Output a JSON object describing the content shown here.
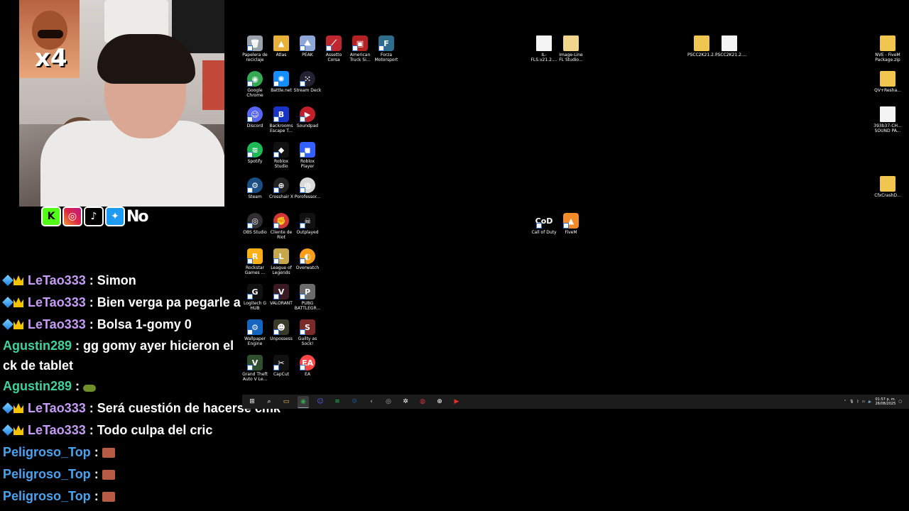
{
  "overlay": {
    "multiplier": "x4",
    "social_text": "No"
  },
  "chat": [
    {
      "user": "LeTao333",
      "badges": true,
      "color": "#c59cf6",
      "text": "Simon"
    },
    {
      "user": "LeTao333",
      "badges": true,
      "color": "#c59cf6",
      "text": "Bien verga pa pegarle a"
    },
    {
      "user": "LeTao333",
      "badges": true,
      "color": "#c59cf6",
      "text": "Bolsa 1-gomy 0"
    },
    {
      "user": "Agustin289",
      "badges": false,
      "color": "#3fd39c",
      "text": "gg gomy ayer hicieron el ck de tablet"
    },
    {
      "user": "Agustin289",
      "badges": false,
      "color": "#3fd39c",
      "text": ""
    },
    {
      "user": "LeTao333",
      "badges": true,
      "color": "#c59cf6",
      "text": "Será cuestión de hacerse cmk"
    },
    {
      "user": "LeTao333",
      "badges": true,
      "color": "#c59cf6",
      "text": "Todo culpa del cric"
    },
    {
      "user": "Peligroso_Top",
      "badges": false,
      "color": "#4aa3f0",
      "text": ""
    },
    {
      "user": "Peligroso_Top",
      "badges": false,
      "color": "#4aa3f0",
      "text": ""
    },
    {
      "user": "Peligroso_Top",
      "badges": false,
      "color": "#4aa3f0",
      "text": ""
    }
  ],
  "desktop_icons": [
    {
      "label": "Papelera de reciclaje",
      "icon": "recycle-bin-icon",
      "color": "#9aa3ad",
      "glyph": "🗑"
    },
    {
      "label": "Atlas",
      "icon": "folder-icon",
      "color": "#e8b23a",
      "glyph": "▲"
    },
    {
      "label": "PEAK",
      "icon": "peak-icon",
      "color": "#8fa6d8",
      "glyph": "⛰"
    },
    {
      "label": "Assetto Corsa",
      "icon": "assetto-corsa-icon",
      "color": "#c0262d",
      "glyph": "⟋"
    },
    {
      "label": "American Truck Si...",
      "icon": "truck-icon",
      "color": "#b22222",
      "glyph": "▣"
    },
    {
      "label": "Forza Motorsport",
      "icon": "forza-icon",
      "color": "#2d6c8a",
      "glyph": "F"
    },
    {
      "label": "Google Chrome",
      "icon": "chrome-icon",
      "color": "#34a853",
      "glyph": "◉"
    },
    {
      "label": "Battle.net",
      "icon": "battlenet-icon",
      "color": "#148eff",
      "glyph": "✺"
    },
    {
      "label": "Stream Deck",
      "icon": "stream-deck-icon",
      "color": "#222233",
      "glyph": "⁙"
    },
    {
      "label": "Discord",
      "icon": "discord-icon",
      "color": "#5865f2",
      "glyph": "☺"
    },
    {
      "label": "Backrooms Escape T...",
      "icon": "backrooms-icon",
      "color": "#1a33c7",
      "glyph": "B"
    },
    {
      "label": "Soundpad",
      "icon": "soundpad-icon",
      "color": "#c0202a",
      "glyph": "▶"
    },
    {
      "label": "Spotify",
      "icon": "spotify-icon",
      "color": "#1db954",
      "glyph": "≋"
    },
    {
      "label": "Roblox Studio",
      "icon": "roblox-studio-icon",
      "color": "#111111",
      "glyph": "◆"
    },
    {
      "label": "Roblox Player",
      "icon": "roblox-icon",
      "color": "#335fff",
      "glyph": "◼"
    },
    {
      "label": "Steam",
      "icon": "steam-icon",
      "color": "#1b4f83",
      "glyph": "⚙"
    },
    {
      "label": "Crosshair X",
      "icon": "crosshair-icon",
      "color": "#222222",
      "glyph": "⊕"
    },
    {
      "label": "Porofessor...",
      "icon": "porofessor-icon",
      "color": "#d9d9d9",
      "glyph": "◍"
    },
    {
      "label": "OBS Studio",
      "icon": "obs-icon",
      "color": "#302e31",
      "glyph": "◎"
    },
    {
      "label": "Cliente de Riot",
      "icon": "riot-icon",
      "color": "#d13639",
      "glyph": "✊"
    },
    {
      "label": "Outplayed",
      "icon": "outplayed-icon",
      "color": "#111111",
      "glyph": "☠"
    },
    {
      "label": "Rockstar Games ...",
      "icon": "rockstar-icon",
      "color": "#fcaf17",
      "glyph": "R"
    },
    {
      "label": "League of Legends",
      "icon": "league-icon",
      "color": "#c8a64b",
      "glyph": "L"
    },
    {
      "label": "Overwatch",
      "icon": "overwatch-icon",
      "color": "#f99e1a",
      "glyph": "◐"
    },
    {
      "label": "Logitech G HUB",
      "icon": "logitech-icon",
      "color": "#111111",
      "glyph": "G"
    },
    {
      "label": "VALORANT",
      "icon": "valorant-icon",
      "color": "#3a1a22",
      "glyph": "V"
    },
    {
      "label": "PUBG BATTLEGR...",
      "icon": "pubg-icon",
      "color": "#6b6b6b",
      "glyph": "P"
    },
    {
      "label": "Wallpaper Engine",
      "icon": "wallpaper-engine-icon",
      "color": "#1565c0",
      "glyph": "⚙"
    },
    {
      "label": "Unpossess",
      "icon": "unpossess-icon",
      "color": "#3a3a2a",
      "glyph": "☻"
    },
    {
      "label": "Guilty as Sock!",
      "icon": "guilty-as-sock-icon",
      "color": "#7a2a2a",
      "glyph": "S"
    },
    {
      "label": "Grand Theft Auto V Le...",
      "icon": "gta-icon",
      "color": "#2f4f2f",
      "glyph": "V"
    },
    {
      "label": "CapCut",
      "icon": "capcut-icon",
      "color": "#111111",
      "glyph": "✂"
    },
    {
      "label": "EA",
      "icon": "ea-icon",
      "color": "#ff4747",
      "glyph": "EA"
    },
    {
      "label": "IL-FLS.v21.2....",
      "icon": "file-icon",
      "color": "#f4f4f4",
      "glyph": ""
    },
    {
      "label": "Image-Line FL Studio...",
      "icon": "folder-icon",
      "color": "#f0d58a",
      "glyph": ""
    },
    {
      "label": "PSCC2K21.2....",
      "icon": "folder-icon",
      "color": "#f0c550",
      "glyph": ""
    },
    {
      "label": "PSCC2K21.2....",
      "icon": "file-icon",
      "color": "#f4f4f4",
      "glyph": ""
    },
    {
      "label": "NVE - FiveM Package.zip",
      "icon": "zip-folder-icon",
      "color": "#f0c550",
      "glyph": ""
    },
    {
      "label": "QV+Resha...",
      "icon": "zip-folder-icon",
      "color": "#f0c550",
      "glyph": ""
    },
    {
      "label": "393b37-CH... SOUND PA...",
      "icon": "file-icon",
      "color": "#f4f4f4",
      "glyph": ""
    },
    {
      "label": "CfxCrashD...",
      "icon": "zip-folder-icon",
      "color": "#f0c550",
      "glyph": ""
    },
    {
      "label": "Call of Duty",
      "icon": "call-of-duty-icon",
      "color": "#000000",
      "glyph": "CoD"
    },
    {
      "label": "FiveM",
      "icon": "fivem-icon",
      "color": "#f48b28",
      "glyph": "▲"
    }
  ],
  "taskbar": {
    "items": [
      {
        "icon": "windows-start-icon",
        "glyph": "⊞",
        "color": "#ffffff"
      },
      {
        "icon": "search-icon",
        "glyph": "⌕",
        "color": "#ffffff"
      },
      {
        "icon": "file-explorer-icon",
        "glyph": "▭",
        "color": "#f0c550"
      },
      {
        "icon": "chrome-icon",
        "glyph": "◉",
        "color": "#34a853"
      },
      {
        "icon": "discord-icon",
        "glyph": "☺",
        "color": "#5865f2"
      },
      {
        "icon": "spotify-icon",
        "glyph": "≋",
        "color": "#1db954"
      },
      {
        "icon": "steam-icon",
        "glyph": "⚙",
        "color": "#1b4f83"
      },
      {
        "icon": "app-icon",
        "glyph": "‹",
        "color": "#cccccc"
      },
      {
        "icon": "obs-icon",
        "glyph": "◎",
        "color": "#aaaaaa"
      },
      {
        "icon": "settings-icon",
        "glyph": "✲",
        "color": "#ffffff"
      },
      {
        "icon": "riot-icon",
        "glyph": "◍",
        "color": "#d13639"
      },
      {
        "icon": "crosshair-icon",
        "glyph": "⊕",
        "color": "#ffffff"
      },
      {
        "icon": "media-player-icon",
        "glyph": "▶",
        "color": "#e52d27"
      }
    ],
    "clock_time": "01:57 p. m.",
    "clock_date": "26/08/2025"
  }
}
